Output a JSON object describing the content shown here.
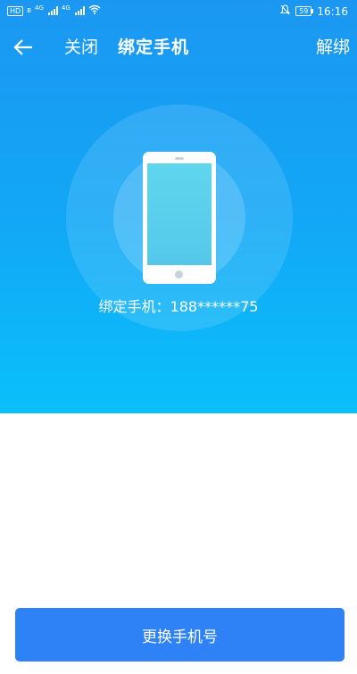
{
  "status_bar": {
    "hd_badge": "HD",
    "hd_sub": "B",
    "signal1_label": "4G",
    "signal2_label": "4G",
    "battery": "59",
    "time": "16:16"
  },
  "nav": {
    "close_label": "关闭",
    "title": "绑定手机",
    "unbind_label": "解绑"
  },
  "main": {
    "bound_phone_text": "绑定手机：188******75"
  },
  "footer": {
    "change_phone_label": "更换手机号"
  },
  "colors": {
    "header_top": "#1b97f2",
    "header_bottom": "#0ac0fb",
    "button": "#2e82f6"
  },
  "icons": {
    "back": "arrow-left-icon",
    "phone": "smartphone-icon",
    "wifi": "wifi-icon",
    "mute": "bell-off-icon"
  }
}
